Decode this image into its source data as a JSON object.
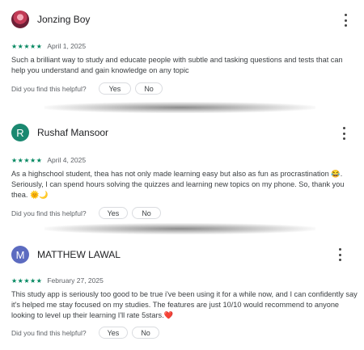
{
  "reviews": [
    {
      "author": "Jonzing Boy",
      "avatar_letter": "",
      "avatar_kind": "photo",
      "rating": 5,
      "stars": "★★★★★",
      "date": "April 1, 2025",
      "text": "Such a brilliant way to study and educate people with subtle and tasking questions and tests that can help you understand and gain knowledge on any topic",
      "helpful_prompt": "Did you find this helpful?",
      "yes_label": "Yes",
      "no_label": "No"
    },
    {
      "author": "Rushaf Mansoor",
      "avatar_letter": "R",
      "avatar_kind": "letter",
      "rating": 5,
      "stars": "★★★★★",
      "date": "April 4, 2025",
      "text": "As a highschool student, thea has not only made learning easy but also as fun as procrastination 😂. Seriously, I can spend hours solving the quizzes and learning new topics on my phone. So, thank you thea. 🌞🌙",
      "helpful_prompt": "Did you find this helpful?",
      "yes_label": "Yes",
      "no_label": "No"
    },
    {
      "author": "MATTHEW LAWAL",
      "avatar_letter": "M",
      "avatar_kind": "letter",
      "rating": 5,
      "stars": "★★★★★",
      "date": "February 27, 2025",
      "text": "This study app is seriously too good to be true i've been using it for a while now, and I can confidently say it's helped me stay focused on my studies. The features are just 10/10 would recommend to anyone looking to level up their learning I'll rate 5stars.❤️",
      "helpful_prompt": "Did you find this helpful?",
      "yes_label": "Yes",
      "no_label": "No"
    }
  ],
  "colors": {
    "star": "#01875f",
    "avatar_teal": "#1a8870",
    "avatar_indigo": "#5c6bc0"
  },
  "icons": {
    "menu": "more-vert-icon",
    "star": "star-icon"
  }
}
